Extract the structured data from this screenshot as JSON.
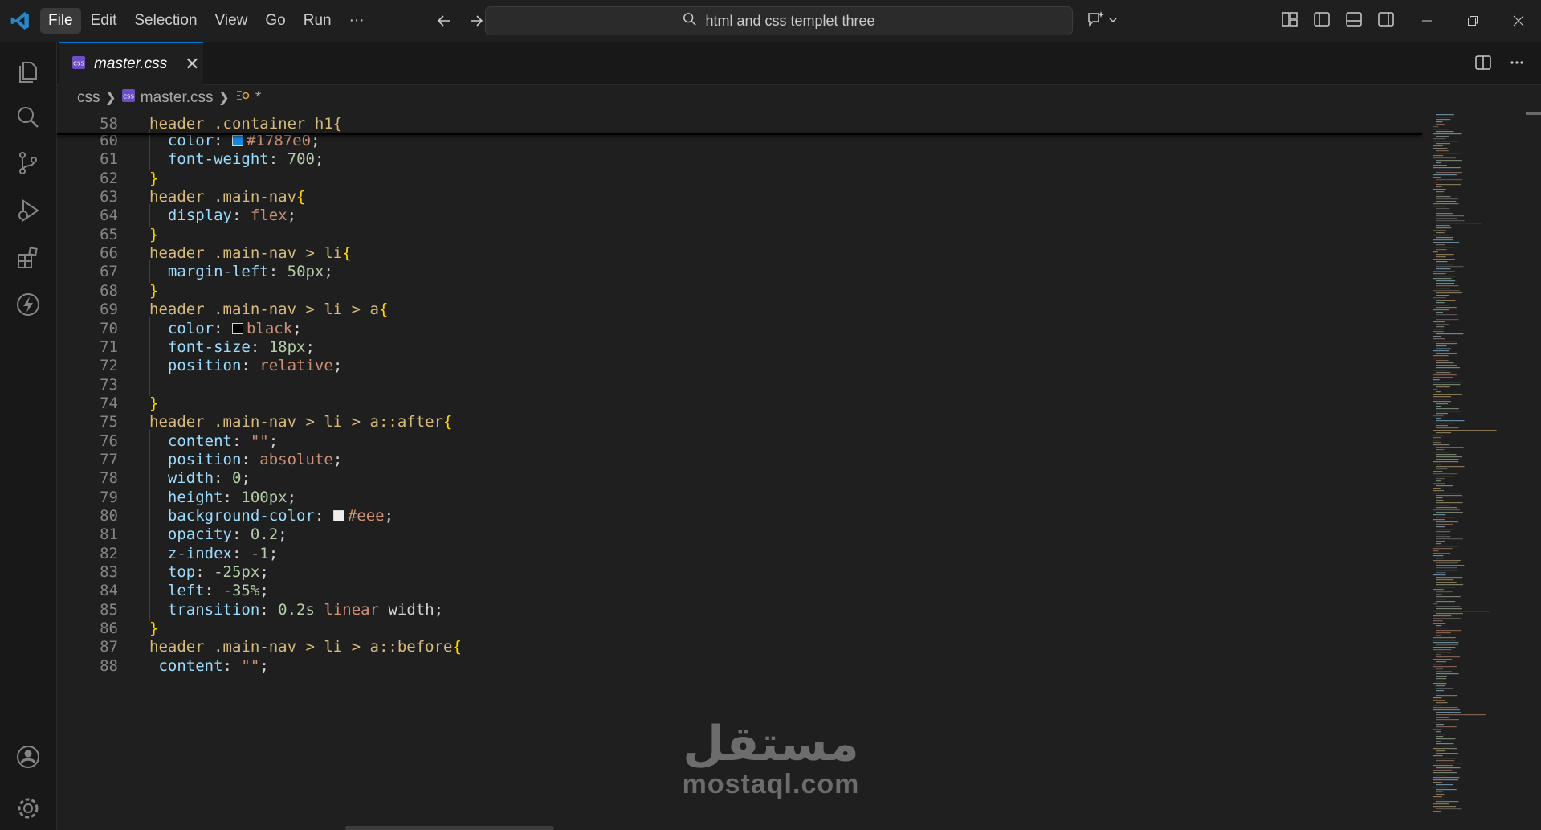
{
  "menu": {
    "items": [
      "File",
      "Edit",
      "Selection",
      "View",
      "Go",
      "Run",
      "···"
    ],
    "active": "File"
  },
  "search": {
    "text": "html and css templet three"
  },
  "tab": {
    "label": "master.css",
    "close": "✕"
  },
  "breadcrumb": {
    "folder": "css",
    "file": "master.css",
    "symbol": "*"
  },
  "colors": {
    "accent": "#0078d4",
    "swatch_blue": "#1787e0",
    "swatch_black": "#000000",
    "swatch_eee": "#eeeeee"
  },
  "editor": {
    "sticky_line": {
      "number": "58",
      "text": "header .container h1{"
    },
    "lines": [
      {
        "n": "60",
        "tokens": [
          {
            "t": "  "
          },
          {
            "t": "color",
            "c": "prop"
          },
          {
            "t": ": "
          },
          {
            "sw": "swatch_blue"
          },
          {
            "t": "#1787e0",
            "c": "val"
          },
          {
            "t": ";"
          }
        ]
      },
      {
        "n": "61",
        "tokens": [
          {
            "t": "  "
          },
          {
            "t": "font-weight",
            "c": "prop"
          },
          {
            "t": ": "
          },
          {
            "t": "700",
            "c": "num"
          },
          {
            "t": ";"
          }
        ]
      },
      {
        "n": "62",
        "tokens": [
          {
            "t": "}",
            "c": "brace"
          }
        ]
      },
      {
        "n": "63",
        "tokens": [
          {
            "t": "header .main-nav",
            "c": "sel"
          },
          {
            "t": "{",
            "c": "brace"
          }
        ]
      },
      {
        "n": "64",
        "tokens": [
          {
            "t": "  "
          },
          {
            "t": "display",
            "c": "prop"
          },
          {
            "t": ": "
          },
          {
            "t": "flex",
            "c": "val"
          },
          {
            "t": ";"
          }
        ]
      },
      {
        "n": "65",
        "tokens": [
          {
            "t": "}",
            "c": "brace"
          }
        ]
      },
      {
        "n": "66",
        "tokens": [
          {
            "t": "header .main-nav > li",
            "c": "sel"
          },
          {
            "t": "{",
            "c": "brace"
          }
        ]
      },
      {
        "n": "67",
        "tokens": [
          {
            "t": "  "
          },
          {
            "t": "margin-left",
            "c": "prop"
          },
          {
            "t": ": "
          },
          {
            "t": "50px",
            "c": "num"
          },
          {
            "t": ";"
          }
        ]
      },
      {
        "n": "68",
        "tokens": [
          {
            "t": "}",
            "c": "brace"
          }
        ]
      },
      {
        "n": "69",
        "tokens": [
          {
            "t": "header .main-nav > li > a",
            "c": "sel"
          },
          {
            "t": "{",
            "c": "brace"
          }
        ]
      },
      {
        "n": "70",
        "tokens": [
          {
            "t": "  "
          },
          {
            "t": "color",
            "c": "prop"
          },
          {
            "t": ": "
          },
          {
            "sw": "swatch_black"
          },
          {
            "t": "black",
            "c": "val"
          },
          {
            "t": ";"
          }
        ]
      },
      {
        "n": "71",
        "tokens": [
          {
            "t": "  "
          },
          {
            "t": "font-size",
            "c": "prop"
          },
          {
            "t": ": "
          },
          {
            "t": "18px",
            "c": "num"
          },
          {
            "t": ";"
          }
        ]
      },
      {
        "n": "72",
        "tokens": [
          {
            "t": "  "
          },
          {
            "t": "position",
            "c": "prop"
          },
          {
            "t": ": "
          },
          {
            "t": "relative",
            "c": "val"
          },
          {
            "t": ";"
          }
        ]
      },
      {
        "n": "73",
        "tokens": [
          {
            "t": ""
          }
        ]
      },
      {
        "n": "74",
        "tokens": [
          {
            "t": "}",
            "c": "brace"
          }
        ]
      },
      {
        "n": "75",
        "tokens": [
          {
            "t": "header .main-nav > li > a::after",
            "c": "sel"
          },
          {
            "t": "{",
            "c": "brace"
          }
        ]
      },
      {
        "n": "76",
        "tokens": [
          {
            "t": "  "
          },
          {
            "t": "content",
            "c": "prop"
          },
          {
            "t": ": "
          },
          {
            "t": "\"\"",
            "c": "val"
          },
          {
            "t": ";"
          }
        ]
      },
      {
        "n": "77",
        "tokens": [
          {
            "t": "  "
          },
          {
            "t": "position",
            "c": "prop"
          },
          {
            "t": ": "
          },
          {
            "t": "absolute",
            "c": "val"
          },
          {
            "t": ";"
          }
        ]
      },
      {
        "n": "78",
        "tokens": [
          {
            "t": "  "
          },
          {
            "t": "width",
            "c": "prop"
          },
          {
            "t": ": "
          },
          {
            "t": "0",
            "c": "num"
          },
          {
            "t": ";"
          }
        ]
      },
      {
        "n": "79",
        "tokens": [
          {
            "t": "  "
          },
          {
            "t": "height",
            "c": "prop"
          },
          {
            "t": ": "
          },
          {
            "t": "100px",
            "c": "num"
          },
          {
            "t": ";"
          }
        ]
      },
      {
        "n": "80",
        "tokens": [
          {
            "t": "  "
          },
          {
            "t": "background-color",
            "c": "prop"
          },
          {
            "t": ": "
          },
          {
            "sw": "swatch_eee"
          },
          {
            "t": "#eee",
            "c": "val"
          },
          {
            "t": ";"
          }
        ]
      },
      {
        "n": "81",
        "tokens": [
          {
            "t": "  "
          },
          {
            "t": "opacity",
            "c": "prop"
          },
          {
            "t": ": "
          },
          {
            "t": "0.2",
            "c": "num"
          },
          {
            "t": ";"
          }
        ]
      },
      {
        "n": "82",
        "tokens": [
          {
            "t": "  "
          },
          {
            "t": "z-index",
            "c": "prop"
          },
          {
            "t": ": "
          },
          {
            "t": "-1",
            "c": "num"
          },
          {
            "t": ";"
          }
        ]
      },
      {
        "n": "83",
        "tokens": [
          {
            "t": "  "
          },
          {
            "t": "top",
            "c": "prop"
          },
          {
            "t": ": "
          },
          {
            "t": "-25px",
            "c": "num"
          },
          {
            "t": ";"
          }
        ]
      },
      {
        "n": "84",
        "tokens": [
          {
            "t": "  "
          },
          {
            "t": "left",
            "c": "prop"
          },
          {
            "t": ": "
          },
          {
            "t": "-35%",
            "c": "num"
          },
          {
            "t": ";"
          }
        ]
      },
      {
        "n": "85",
        "tokens": [
          {
            "t": "  "
          },
          {
            "t": "transition",
            "c": "prop"
          },
          {
            "t": ": "
          },
          {
            "t": "0.2s",
            "c": "num"
          },
          {
            "t": " "
          },
          {
            "t": "linear",
            "c": "val"
          },
          {
            "t": " width;"
          }
        ]
      },
      {
        "n": "86",
        "tokens": [
          {
            "t": "}",
            "c": "brace"
          }
        ]
      },
      {
        "n": "87",
        "tokens": [
          {
            "t": "header .main-nav > li > a::before",
            "c": "sel"
          },
          {
            "t": "{",
            "c": "brace"
          }
        ]
      },
      {
        "n": "88",
        "tokens": [
          {
            "t": " "
          },
          {
            "t": "content",
            "c": "prop"
          },
          {
            "t": ": "
          },
          {
            "t": "\"\"",
            "c": "val"
          },
          {
            "t": ";"
          }
        ]
      }
    ]
  },
  "watermark": {
    "arabic": "مستقل",
    "latin": "mostaql.com"
  },
  "icons": {
    "activity": [
      "explorer-icon",
      "search-icon",
      "source-control-icon",
      "run-debug-icon",
      "extensions-icon",
      "lightning-icon",
      "account-icon",
      "settings-icon"
    ]
  }
}
